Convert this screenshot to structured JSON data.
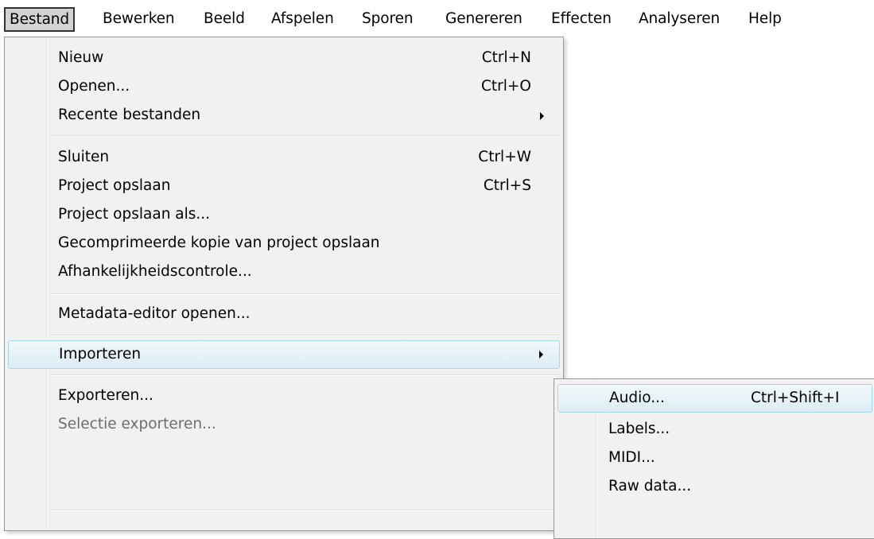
{
  "menubar": {
    "items": [
      {
        "label": "Bestand",
        "active": true
      },
      {
        "label": "Bewerken"
      },
      {
        "label": "Beeld"
      },
      {
        "label": "Afspelen"
      },
      {
        "label": "Sporen"
      },
      {
        "label": "Genereren"
      },
      {
        "label": "Effecten"
      },
      {
        "label": "Analyseren"
      },
      {
        "label": "Help"
      }
    ]
  },
  "file_menu": {
    "items": [
      {
        "label": "Nieuw",
        "shortcut": "Ctrl+N"
      },
      {
        "label": "Openen...",
        "shortcut": "Ctrl+O"
      },
      {
        "label": "Recente bestanden",
        "submenu": true
      },
      {
        "label": "Sluiten",
        "shortcut": "Ctrl+W"
      },
      {
        "label": "Project opslaan",
        "shortcut": "Ctrl+S"
      },
      {
        "label": "Project opslaan als..."
      },
      {
        "label": "Gecomprimeerde kopie van project opslaan"
      },
      {
        "label": "Afhankelijkheidscontrole..."
      },
      {
        "label": "Metadata-editor openen..."
      },
      {
        "label": "Importeren",
        "submenu": true,
        "highlighted": true
      },
      {
        "label": "Exporteren..."
      },
      {
        "label": "Selectie exporteren...",
        "disabled": true
      }
    ]
  },
  "import_submenu": {
    "items": [
      {
        "label": "Audio...",
        "shortcut": "Ctrl+Shift+I",
        "highlighted": true
      },
      {
        "label": "Labels..."
      },
      {
        "label": "MIDI..."
      },
      {
        "label": "Raw data..."
      }
    ]
  }
}
